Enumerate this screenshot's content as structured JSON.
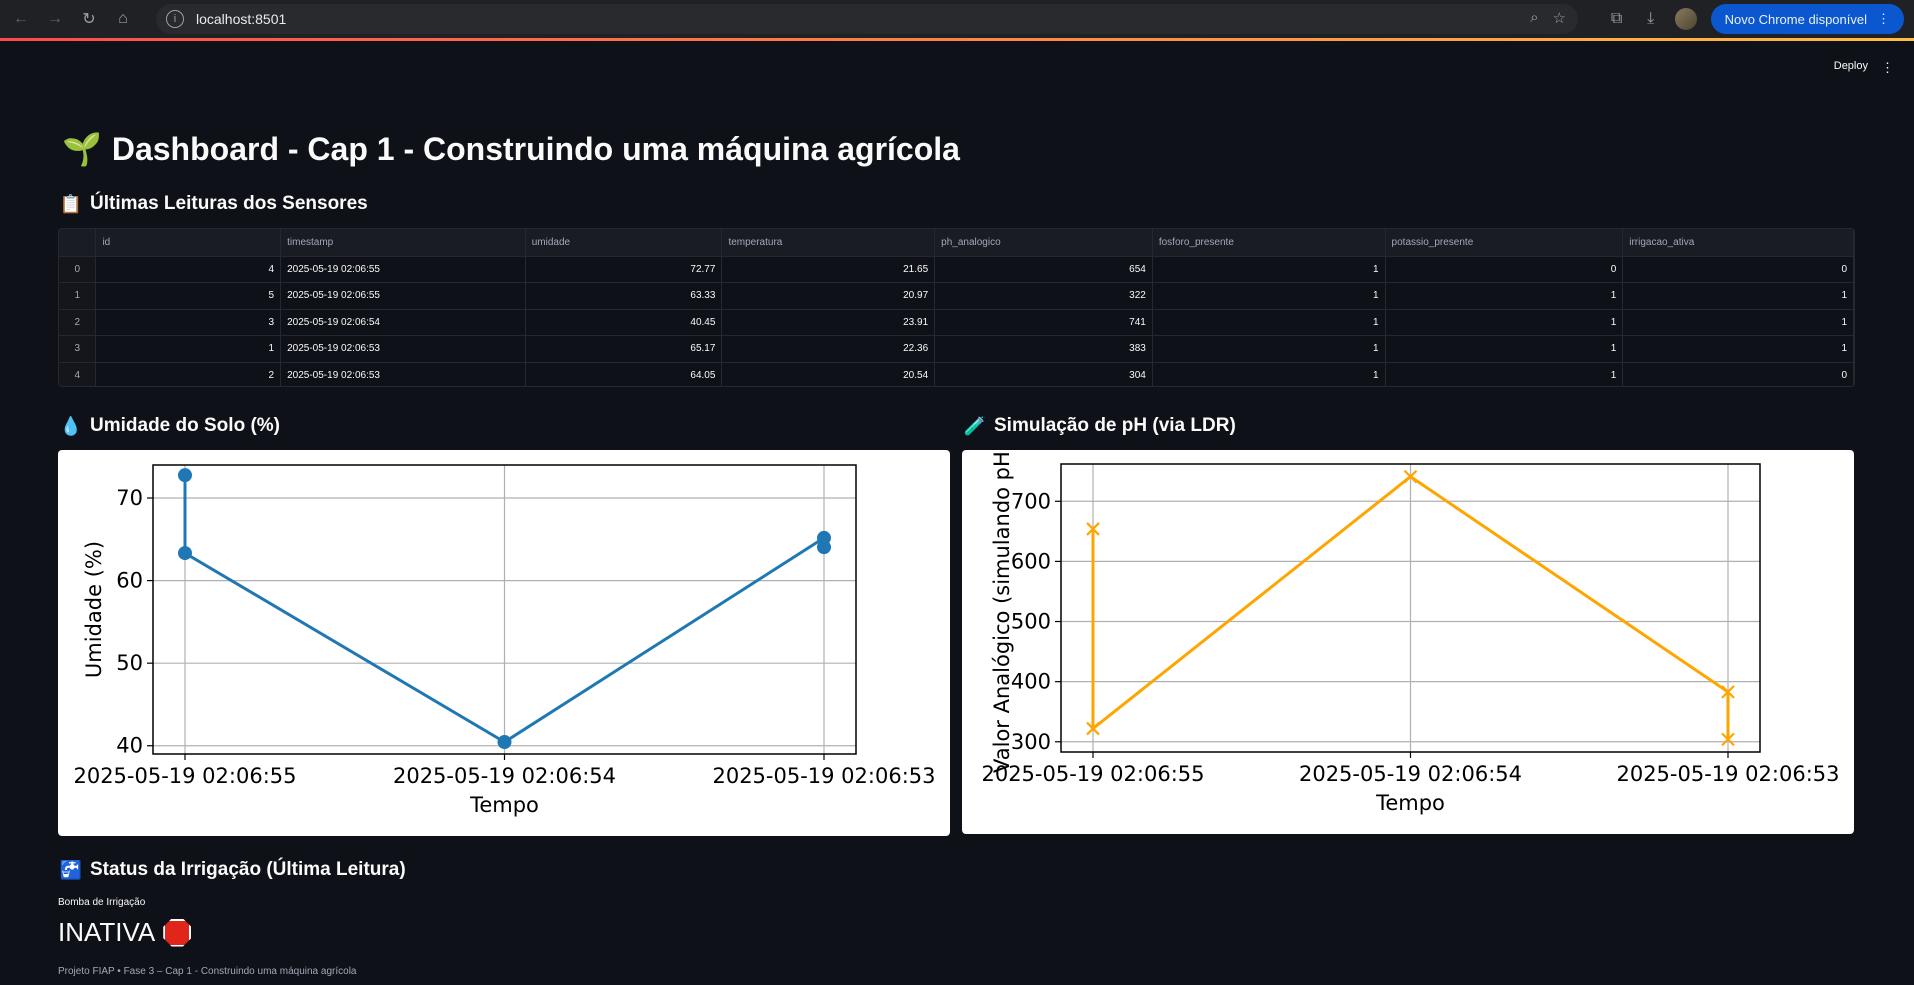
{
  "browser": {
    "url": "localhost:8501",
    "update_label": "Novo Chrome disponível"
  },
  "app": {
    "deploy_label": "Deploy",
    "title": "Dashboard - Cap 1 - Construindo uma máquina agrícola",
    "title_emoji": "🌱",
    "table_section": {
      "emoji": "📋",
      "title": "Últimas Leituras dos Sensores"
    },
    "table": {
      "columns": [
        "",
        "id",
        "timestamp",
        "umidade",
        "temperatura",
        "ph_analogico",
        "fosforo_presente",
        "potassio_presente",
        "irrigacao_ativa"
      ],
      "rows": [
        [
          "0",
          "4",
          "2025-05-19 02:06:55",
          "72.77",
          "21.65",
          "654",
          "1",
          "0",
          "0"
        ],
        [
          "1",
          "5",
          "2025-05-19 02:06:55",
          "63.33",
          "20.97",
          "322",
          "1",
          "1",
          "1"
        ],
        [
          "2",
          "3",
          "2025-05-19 02:06:54",
          "40.45",
          "23.91",
          "741",
          "1",
          "1",
          "1"
        ],
        [
          "3",
          "1",
          "2025-05-19 02:06:53",
          "65.17",
          "22.36",
          "383",
          "1",
          "1",
          "1"
        ],
        [
          "4",
          "2",
          "2025-05-19 02:06:53",
          "64.05",
          "20.54",
          "304",
          "1",
          "1",
          "0"
        ]
      ]
    },
    "humidity_section": {
      "emoji": "💧",
      "title": "Umidade do Solo (%)"
    },
    "ph_section": {
      "emoji": "🧪",
      "title": "Simulação de pH (via LDR)"
    },
    "status_section": {
      "emoji": "🚰",
      "title": "Status da Irrigação (Última Leitura)"
    },
    "metric": {
      "label": "Bomba de Irrigação",
      "value": "INATIVA"
    },
    "footer": "Projeto FIAP • Fase 3 – Cap 1 - Construindo uma máquina agrícola"
  },
  "chart_data": [
    {
      "type": "line",
      "x_categories": [
        "2025-05-19 02:06:55",
        "2025-05-19 02:06:54",
        "2025-05-19 02:06:53"
      ],
      "x": [
        "2025-05-19 02:06:55",
        "2025-05-19 02:06:55",
        "2025-05-19 02:06:54",
        "2025-05-19 02:06:53",
        "2025-05-19 02:06:53"
      ],
      "y": [
        72.77,
        63.33,
        40.45,
        65.17,
        64.05
      ],
      "xlabel": "Tempo",
      "ylabel": "Umidade (%)",
      "yticks": [
        40,
        50,
        60,
        70
      ],
      "ylim": [
        39,
        74
      ],
      "marker": "o",
      "color": "#1f77b4",
      "grid": true
    },
    {
      "type": "line",
      "x_categories": [
        "2025-05-19 02:06:55",
        "2025-05-19 02:06:54",
        "2025-05-19 02:06:53"
      ],
      "x": [
        "2025-05-19 02:06:55",
        "2025-05-19 02:06:55",
        "2025-05-19 02:06:54",
        "2025-05-19 02:06:53",
        "2025-05-19 02:06:53"
      ],
      "y": [
        654,
        322,
        741,
        383,
        304
      ],
      "xlabel": "Tempo",
      "ylabel": "Valor Analógico (simulando pH)",
      "yticks": [
        300,
        400,
        500,
        600,
        700
      ],
      "ylim": [
        283,
        762
      ],
      "marker": "x",
      "color": "#ffa500",
      "grid": true
    }
  ]
}
